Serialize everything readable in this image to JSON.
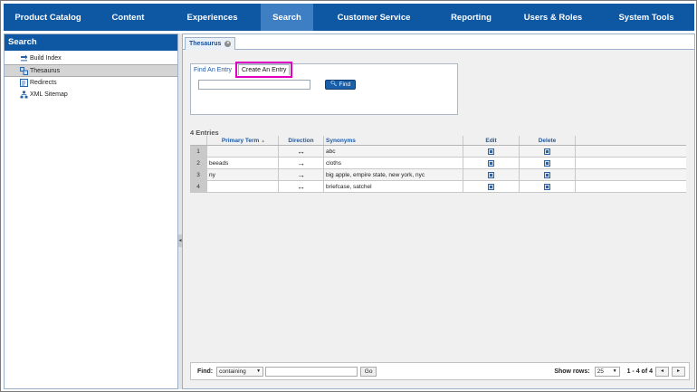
{
  "nav": {
    "items": [
      {
        "label": "Product Catalog"
      },
      {
        "label": "Content"
      },
      {
        "label": "Experiences"
      },
      {
        "label": "Search"
      },
      {
        "label": "Customer Service"
      },
      {
        "label": "Reporting"
      },
      {
        "label": "Users & Roles"
      },
      {
        "label": "System Tools"
      }
    ],
    "active": "Search"
  },
  "sidebar": {
    "title": "Search",
    "items": [
      {
        "label": "Build Index",
        "icon": "build-index-icon"
      },
      {
        "label": "Thesaurus",
        "icon": "thesaurus-icon",
        "selected": true
      },
      {
        "label": "Redirects",
        "icon": "redirect-icon"
      },
      {
        "label": "XML Sitemap",
        "icon": "sitemap-icon"
      }
    ]
  },
  "tabs": {
    "open_tab": "Thesaurus"
  },
  "search_panel": {
    "find_tab": "Find An Entry",
    "create_tab": "Create An Entry",
    "input_value": "",
    "find_button": "Find"
  },
  "grid": {
    "count_label": "4 Entries",
    "columns": {
      "primary_term": "Primary Term",
      "direction": "Direction",
      "synonyms": "Synonyms",
      "edit": "Edit",
      "delete": "Delete"
    },
    "rows": [
      {
        "num": "1",
        "primary_term": "",
        "direction": "↔",
        "synonyms": "abc"
      },
      {
        "num": "2",
        "primary_term": "beeads",
        "direction": "→",
        "synonyms": "cloths"
      },
      {
        "num": "3",
        "primary_term": "ny",
        "direction": "→",
        "synonyms": "big apple, empire state, new york, nyc"
      },
      {
        "num": "4",
        "primary_term": "",
        "direction": "↔",
        "synonyms": "briefcase, satchel"
      }
    ]
  },
  "footer": {
    "find_label": "Find:",
    "mode": "containing",
    "input_value": "",
    "go_label": "Go",
    "rows_label": "Show rows:",
    "rows_value": "25",
    "range": "1 - 4 of 4"
  },
  "colors": {
    "nav_bg": "#0d57a3",
    "nav_active": "#3e7ec2",
    "highlight": "#e000c0"
  }
}
